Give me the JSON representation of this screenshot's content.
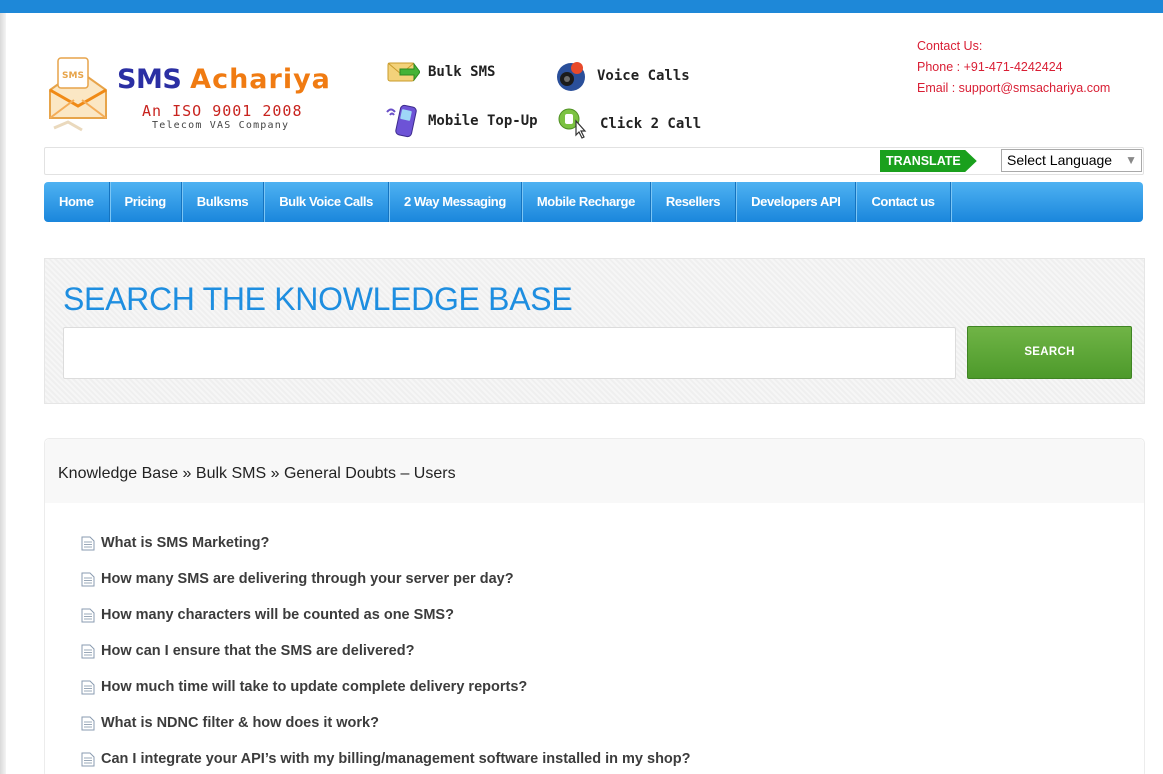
{
  "logo": {
    "brand_part1": "SMS ",
    "brand_part2": "Achariya",
    "iso": "An ISO 9001 2008",
    "tagline": "Telecom VAS Company",
    "envelope_badge": "SMS"
  },
  "services": [
    {
      "label": "Bulk SMS",
      "icon": "envelope-arrow-icon"
    },
    {
      "label": "Voice Calls",
      "icon": "speaker-icon"
    },
    {
      "label": "Mobile Top-Up",
      "icon": "mobile-phone-icon"
    },
    {
      "label": "Click 2 Call",
      "icon": "click-call-icon"
    }
  ],
  "contact": {
    "heading": "Contact Us:",
    "phone": "Phone : +91-471-4242424",
    "email": "Email : support@smsachariya.com"
  },
  "translate": {
    "label": "TRANSLATE",
    "select_value": "Select Language",
    "arrow": "▼"
  },
  "nav": {
    "items": [
      {
        "label": "Home"
      },
      {
        "label": "Pricing"
      },
      {
        "label": "Bulksms"
      },
      {
        "label": "Bulk Voice Calls"
      },
      {
        "label": "2 Way Messaging"
      },
      {
        "label": "Mobile Recharge"
      },
      {
        "label": "Resellers"
      },
      {
        "label": "Developers API"
      },
      {
        "label": "Contact us"
      }
    ]
  },
  "search": {
    "title": "SEARCH THE KNOWLEDGE BASE",
    "placeholder": "",
    "button_label": "SEARCH"
  },
  "breadcrumb": {
    "root": "Knowledge Base",
    "separator": " » ",
    "section": "Bulk SMS",
    "current": "General Doubts – Users"
  },
  "articles": [
    "What is SMS Marketing?",
    "How many SMS are delivering through your server per day?",
    "How many characters will be counted as one SMS?",
    "How can I ensure that the SMS are delivered?",
    "How much time will take to update complete delivery reports?",
    "What is NDNC filter & how does it work?",
    "Can I integrate your API’s with my billing/management software installed in my shop?"
  ],
  "colors": {
    "topbar": "#1e88d8",
    "nav": "#2a95e4",
    "accent_blue": "#1e8ee0",
    "search_button": "#5ea63a",
    "translate_green": "#1aa01d",
    "contact_red": "#d91e34",
    "brand_blue": "#2b2fa3",
    "brand_orange": "#f07b12"
  }
}
